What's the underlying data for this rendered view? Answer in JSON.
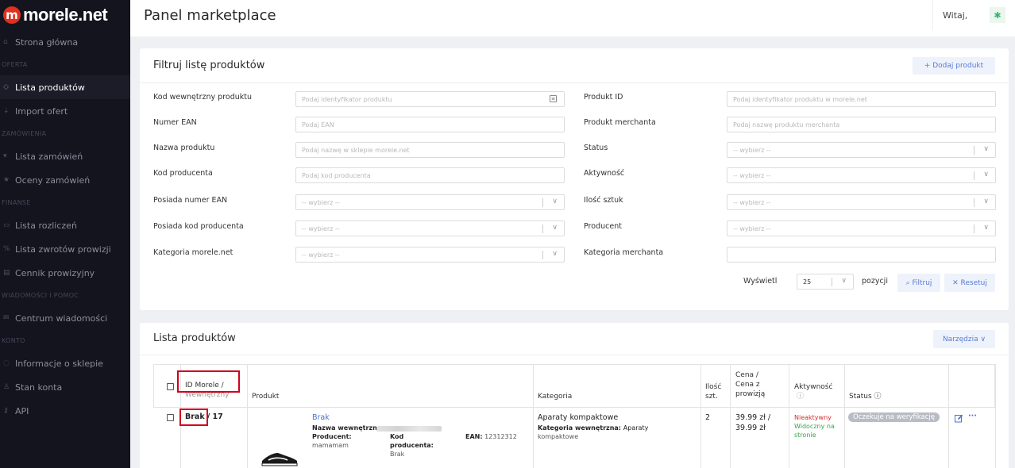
{
  "brand": {
    "logo_mark": "m",
    "logo_text": "morele.net"
  },
  "sidebar": {
    "items": [
      {
        "type": "item",
        "icon": "home-icon",
        "label": "Strona główna"
      },
      {
        "type": "section",
        "label": "OFERTA"
      },
      {
        "type": "item",
        "icon": "list-icon",
        "label": "Lista produktów",
        "active": true
      },
      {
        "type": "item",
        "icon": "upload-icon",
        "label": "Import ofert"
      },
      {
        "type": "section",
        "label": "ZAMÓWIENIA"
      },
      {
        "type": "item",
        "icon": "cart-icon",
        "label": "Lista zamówień"
      },
      {
        "type": "item",
        "icon": "star-icon",
        "label": "Oceny zamówień"
      },
      {
        "type": "section",
        "label": "FINANSE"
      },
      {
        "type": "item",
        "icon": "document-icon",
        "label": "Lista rozliczeń"
      },
      {
        "type": "item",
        "icon": "percent-icon",
        "label": "Lista zwrotów prowizji"
      },
      {
        "type": "item",
        "icon": "table-icon",
        "label": "Cennik prowizyjny"
      },
      {
        "type": "section",
        "label": "WIADOMOŚCI I POMOC"
      },
      {
        "type": "item",
        "icon": "mail-icon",
        "label": "Centrum wiadomości"
      },
      {
        "type": "section",
        "label": "KONTO"
      },
      {
        "type": "item",
        "icon": "info-icon",
        "label": "Informacje o sklepie"
      },
      {
        "type": "item",
        "icon": "user-icon",
        "label": "Stan konta"
      },
      {
        "type": "item",
        "icon": "key-icon",
        "label": "API"
      }
    ]
  },
  "header": {
    "title": "Panel marketplace",
    "greeting": "Witaj,",
    "avatar_icon": "sparkle-icon"
  },
  "filter": {
    "title": "Filtruj listę produktów",
    "add_button": "+ Dodaj produkt",
    "left": [
      {
        "label": "Kod wewnętrzny produktu",
        "kind": "input",
        "placeholder": "Podaj identyfikator produktu",
        "id_icon": true
      },
      {
        "label": "Numer EAN",
        "kind": "input",
        "placeholder": "Podaj EAN"
      },
      {
        "label": "Nazwa produktu",
        "kind": "input",
        "placeholder": "Podaj nazwę w sklepie morele.net"
      },
      {
        "label": "Kod producenta",
        "kind": "input",
        "placeholder": "Podaj kod producenta"
      },
      {
        "label": "Posiada numer EAN",
        "kind": "select",
        "value": "-- wybierz --"
      },
      {
        "label": "Posiada kod producenta",
        "kind": "select",
        "value": "-- wybierz --"
      },
      {
        "label": "Kategoria morele.net",
        "kind": "select",
        "value": "-- wybierz --"
      }
    ],
    "right": [
      {
        "label": "Produkt ID",
        "kind": "input",
        "placeholder": "Podaj identyfikator produktu w morele.net"
      },
      {
        "label": "Produkt merchanta",
        "kind": "input",
        "placeholder": "Podaj nazwę produktu merchanta"
      },
      {
        "label": "Status",
        "kind": "select",
        "value": "-- wybierz --"
      },
      {
        "label": "Aktywność",
        "kind": "select",
        "value": "-- wybierz --"
      },
      {
        "label": "Ilość sztuk",
        "kind": "select",
        "value": "-- wybierz --"
      },
      {
        "label": "Producent",
        "kind": "select",
        "value": "-- wybierz --"
      },
      {
        "label": "Kategoria merchanta",
        "kind": "input",
        "placeholder": ""
      }
    ],
    "show_label": "Wyświetl",
    "page_size": "25",
    "positions_label": "pozycji",
    "filter_button": "⌕ Filtruj",
    "reset_button": "✕ Resetuj"
  },
  "list": {
    "title": "Lista produktów",
    "tools_button": "Narzędzia ∨",
    "headers": {
      "id": [
        "ID Morele /",
        "Wewnętrzny"
      ],
      "product": "Produkt",
      "category": "Kategoria",
      "qty": [
        "Ilość",
        "szt."
      ],
      "price": [
        "Cena /",
        "Cena z",
        "prowizją"
      ],
      "activity": "Aktywność",
      "activity_info": "ⓘ",
      "status": "Status ⓘ"
    },
    "row": {
      "id_morele": "Brak",
      "id_internal": "/ 17",
      "product_name": "Brak",
      "internal_name_label": "Nazwa wewnętrzna:",
      "producer_label": "Producent:",
      "producer_value": "mamamam",
      "code_label": "Kod",
      "code_label2": "producenta:",
      "code_value": "Brak",
      "ean_label": "EAN:",
      "ean_value": "12312312",
      "category": "Aparaty kompaktowe",
      "merchant_category_label": "Kategoria wewnętrzna:",
      "merchant_category_value1": "Aparaty",
      "merchant_category_value2": "kompaktowe",
      "qty": "2",
      "price1": "39.99 zł /",
      "price2": "39.99 zł",
      "activity_inactive": "Nieaktywny",
      "activity_visible1": "Widoczny na",
      "activity_visible2": "stronie",
      "status": "Oczekuje na weryfikację",
      "edit_icon": "edit-icon",
      "more_icon": "more-icon",
      "more_glyph": "···"
    }
  },
  "colors": {
    "sidebar_bg": "#14141e",
    "accent": "#5b7bd5",
    "highlight": "#d0021b"
  }
}
